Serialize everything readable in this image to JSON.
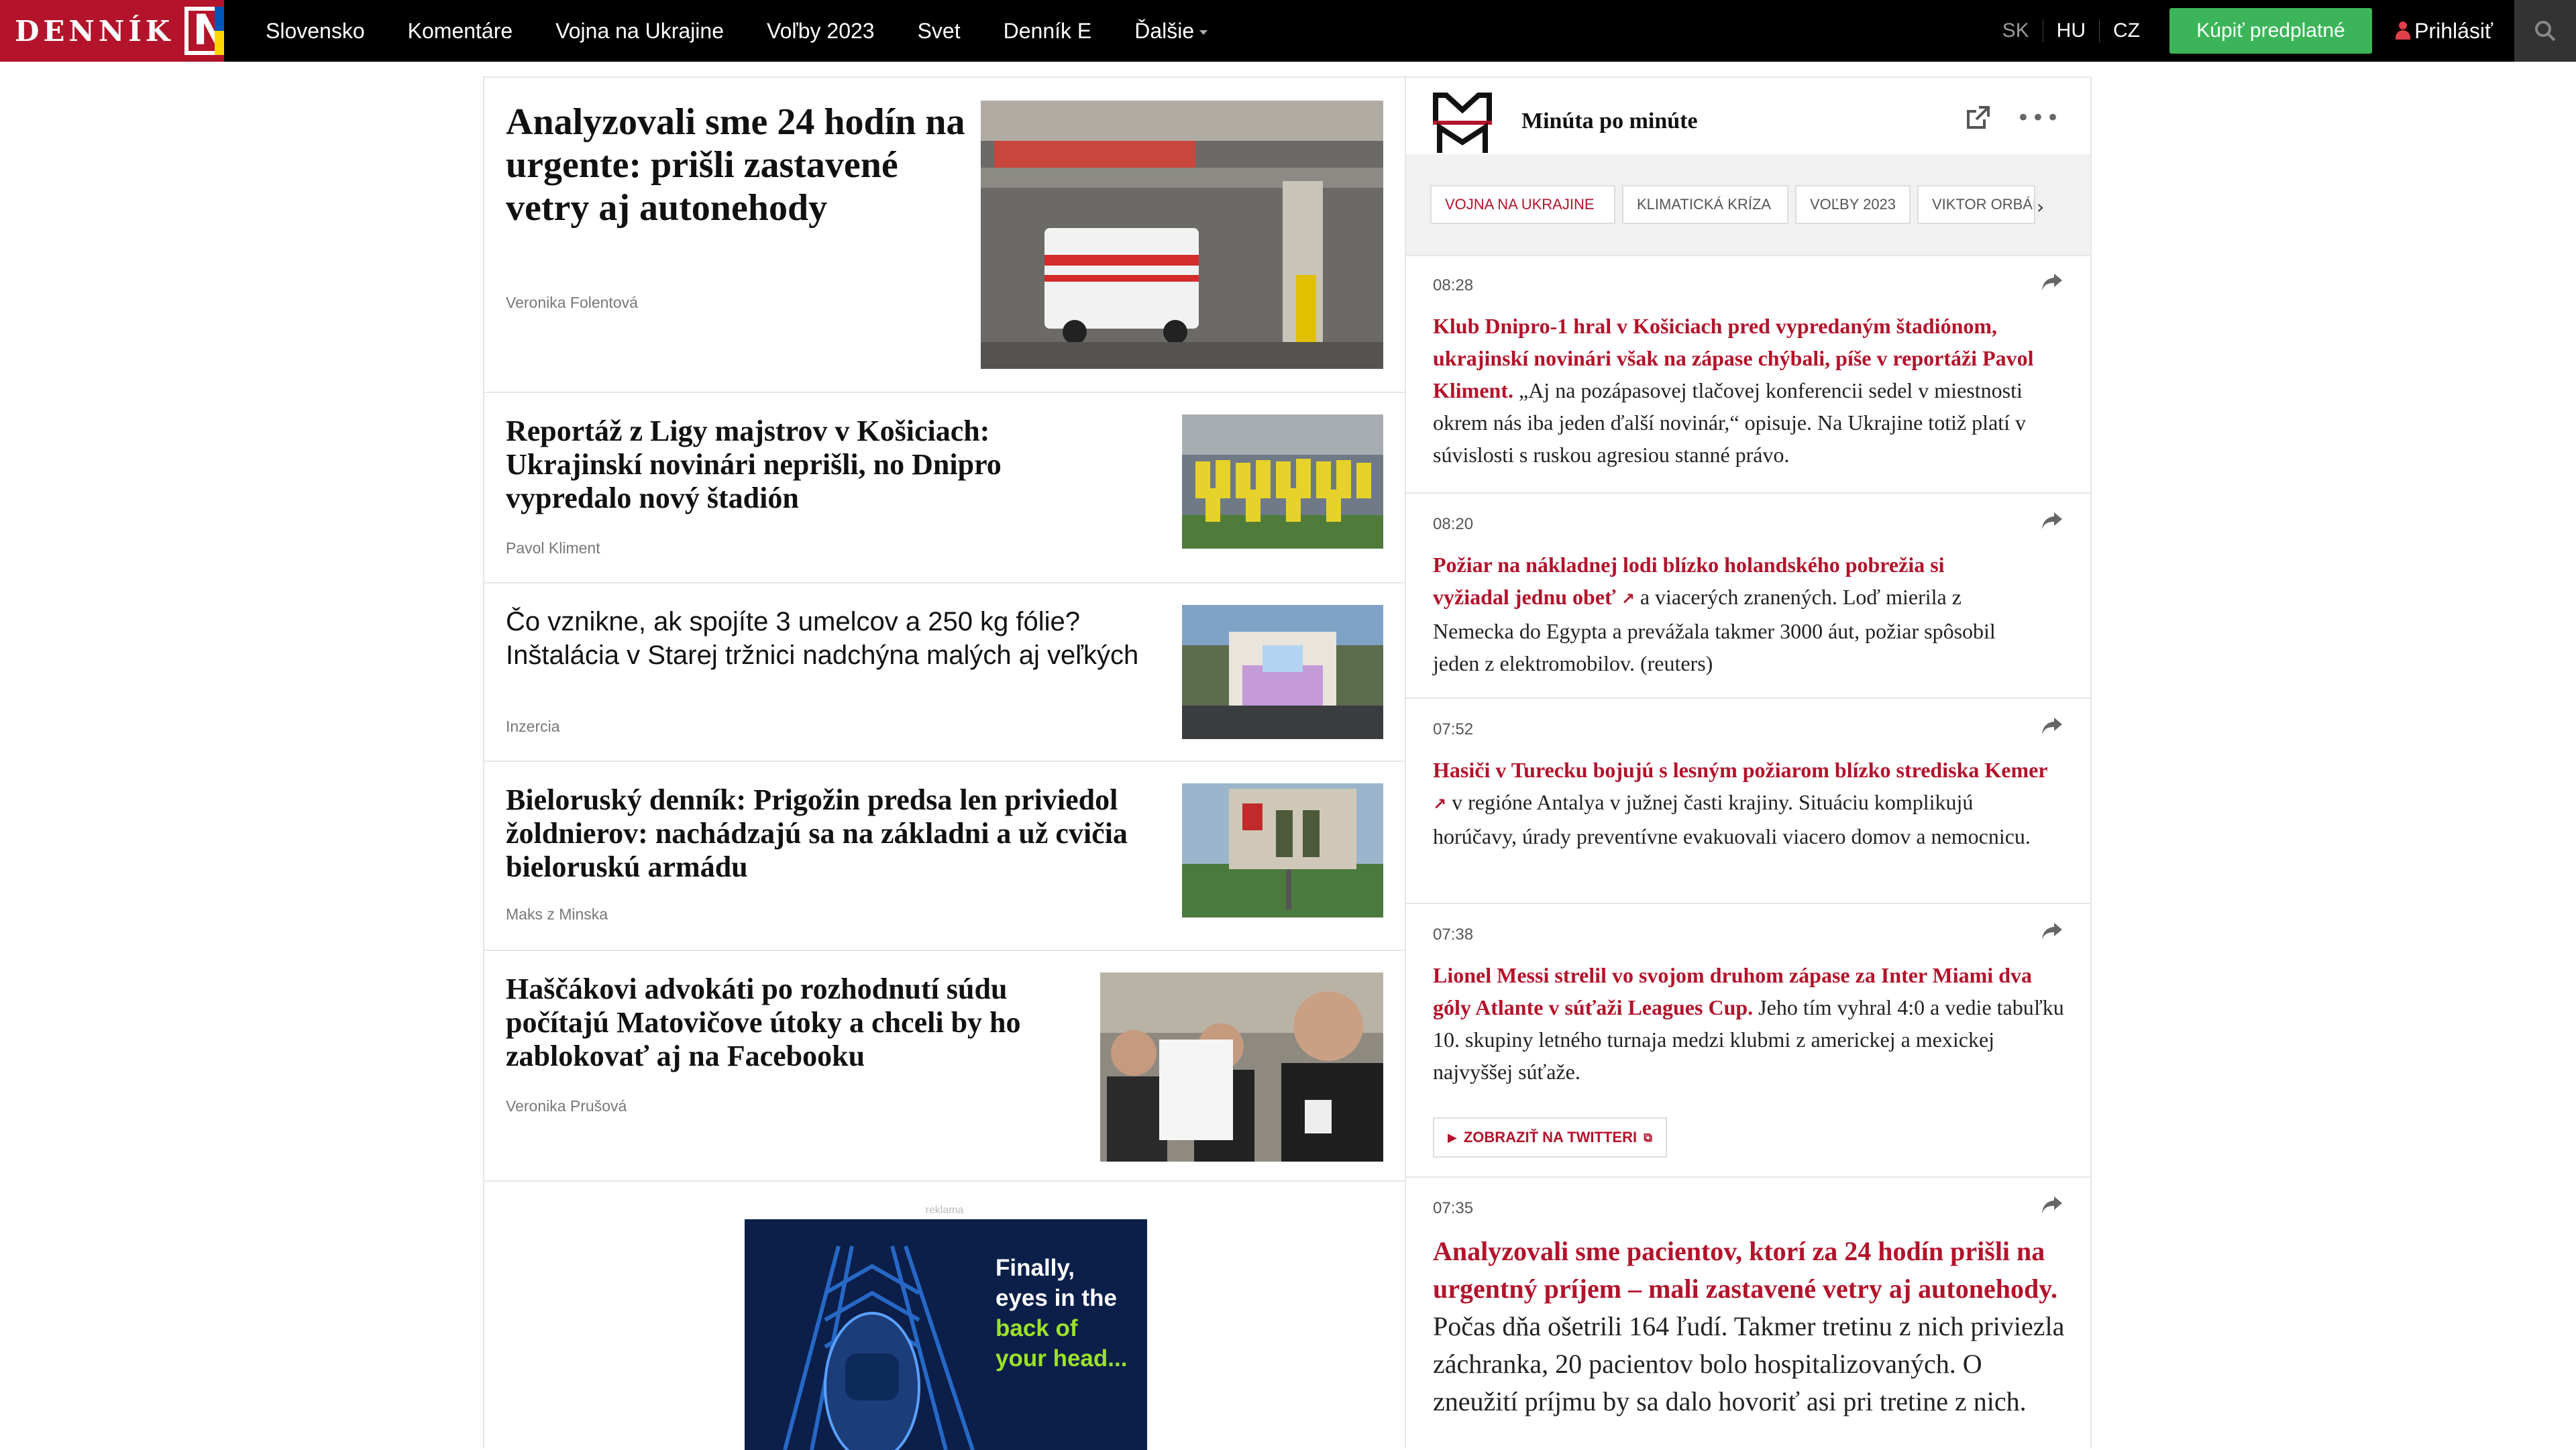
{
  "header": {
    "logo_text": "DENNÍK",
    "logo_mark": "N",
    "nav": [
      "Slovensko",
      "Komentáre",
      "Vojna na Ukrajine",
      "Voľby 2023",
      "Svet",
      "Denník E"
    ],
    "nav_more": "Ďalšie",
    "langs": [
      "SK",
      "HU",
      "CZ"
    ],
    "buy_label": "Kúpiť predplatné",
    "login_label": "Prihlásiť"
  },
  "articles": [
    {
      "title": "Analyzovali sme 24 hodín na urgente: prišli zastavené vetry aj autonehody",
      "author": "Veronika Folentová"
    },
    {
      "title": "Reportáž z Ligy majstrov v Košiciach: Ukrajinskí novinári neprišli, no Dnipro vypredalo nový štadión",
      "author": "Pavol Kliment"
    },
    {
      "title": "Čo vznikne, ak spojíte 3 umelcov a 250 kg fólie? Inštalácia v Starej tržnici nadchýna malých aj veľkých",
      "author": "Inzercia"
    },
    {
      "title": "Bieloruský denník: Prigožin predsa len priviedol žoldnierov: nachádzajú sa na základni a už cvičia bieloruskú armádu",
      "author": "Maks z Minska"
    },
    {
      "title": "Haščákovi advokáti po rozhodnutí súdu počítajú Matovičove útoky a chceli by ho zablokovať aj na Facebooku",
      "author": "Veronika Prušová"
    }
  ],
  "ad": {
    "label": "reklama",
    "line1": "Finally,",
    "line2": "eyes in the",
    "line3": "back of",
    "line4": "your head..."
  },
  "feed": {
    "title": "Minúta po minúte",
    "tags": [
      "Vojna na Ukrajine",
      "Klimatická kríza",
      "Voľby 2023",
      "Viktor Orbán"
    ],
    "posts": [
      {
        "time": "08:28",
        "lead": "Klub Dnipro-1 hral v Košiciach pred vypredaným štadiónom, ukrajinskí novinári však na zápase chýbali, píše v reportáži Pavol Kliment.",
        "text": " „Aj na pozápasovej tlačovej konferencii sedel v miestnosti okrem nás iba jeden ďalší novinár,“ opisuje. Na Ukrajine totiž platí v súvislosti s ruskou agresiou stanné právo."
      },
      {
        "time": "08:20",
        "lead": "Požiar na nákladnej lodi blízko holandského pobrežia si vyžiadal jednu obeť",
        "text": " a viacerých zranených. Loď mierila z Nemecka do Egypta a prevážala takmer 3000 áut, požiar spôsobil jeden z elektromobilov. (reuters)"
      },
      {
        "time": "07:52",
        "lead": "Hasiči v Turecku bojujú s lesným požiarom blízko strediska Kemer",
        "text": " v regióne Antalya v južnej časti krajiny. Situáciu komplikujú horúčavy, úrady preventívne evakuovali viacero domov a nemocnicu."
      },
      {
        "time": "07:38",
        "lead": "Lionel Messi strelil vo svojom druhom zápase za Inter Miami dva góly Atlante v súťaži Leagues Cup.",
        "text": " Jeho tím vyhral 4:0 a vedie tabuľku 10. skupiny letného turnaja medzi klubmi z americkej a mexickej najvyššej súťaže.",
        "button": "Zobraziť na Twitteri"
      },
      {
        "time": "07:35",
        "lead": "Analyzovali sme pacientov, ktorí za 24 hodín prišli na urgentný príjem – mali zastavené vetry aj autonehody.",
        "text": " Počas dňa ošetrili 164 ľudí. Takmer tretinu z nich priviezla záchranka, 20 pacientov bolo hospitalizovaných. O zneužití príjmu by sa dalo hovoriť asi pri tretine z nich."
      }
    ]
  },
  "colors": {
    "brand_red": "#b3132b",
    "buy_green": "#3cb55a",
    "nav_bg": "#000000"
  }
}
